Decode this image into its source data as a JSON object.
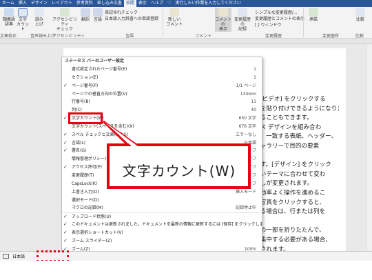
{
  "ribbon": {
    "tabs": [
      "ホーム",
      "挿入",
      "デザイン",
      "レイアウト",
      "参考資料",
      "差し込み文書",
      "校閲",
      "表示",
      "ヘルプ",
      "♡",
      "実行したい作業を入力してください"
    ],
    "active_tab": "校閲",
    "buttons": {
      "thesaurus": "類義語\n辞典",
      "word_count": "文字\nカウント",
      "read_aloud": "読み\n上げ",
      "accessibility": "アクセシビリティ\nチェック",
      "translate": "翻訳",
      "language": "言語",
      "new_comment": "新しい\nコメント",
      "show_comments": "コメントの\n表示",
      "track_changes": "変更履歴の\n記録",
      "accept": "承諾",
      "compare": "比較"
    },
    "small_items": {
      "simplified_check": "表記ゆれチェック",
      "add_dictionary": "日本語入力辞書への単語登録",
      "simple_markup": "シンプルな変更履歴/...",
      "show_markup": "変更履歴とコメントの表示",
      "reviewing_pane": "[ ] ウィンドウ"
    },
    "groups": [
      "文章校正",
      "音声読み上げ",
      "アクセシビリティ",
      "言語",
      "コメント",
      "変更履歴",
      "変更箇所",
      "比較"
    ]
  },
  "menu": {
    "title": "ステータス バーのユーザー設定",
    "items": [
      {
        "label": "書式設定されたページ番号(E)",
        "value": "1",
        "checked": false
      },
      {
        "label": "セクション(E)",
        "value": "1",
        "checked": false
      },
      {
        "label": "ページ番号(P)",
        "value": "1/1 ページ",
        "checked": true
      },
      {
        "label": "ページでの垂直方向の位置(V)",
        "value": "134mm",
        "checked": false
      },
      {
        "label": "行番号(B)",
        "value": "11",
        "checked": false
      },
      {
        "label": "列(C)",
        "value": "40",
        "checked": false
      },
      {
        "label": "文字カウント(W)",
        "value": "650 文字",
        "checked": true
      },
      {
        "label": "文字カウント(スペースを含む)(X)",
        "value": "676 文字",
        "checked": false
      },
      {
        "label": "スペル チェックと文章校正(S)",
        "value": "エラーなし",
        "checked": true
      },
      {
        "label": "言語(L)",
        "value": "日本語",
        "checked": true
      },
      {
        "label": "署名(G)",
        "value": "オフ",
        "checked": true
      },
      {
        "label": "情報管理ポリシー(I)",
        "value": "オフ",
        "checked": false
      },
      {
        "label": "アクセス許可(P)",
        "value": "オフ",
        "checked": true
      },
      {
        "label": "変更履歴(T)",
        "value": "オフ",
        "checked": false
      },
      {
        "label": "CapsLock(K)",
        "value": "オフ",
        "checked": false
      },
      {
        "label": "上書き入力(O)",
        "value": "挿入モード",
        "checked": false
      },
      {
        "label": "選択モード(D)",
        "value": "",
        "checked": false
      },
      {
        "label": "マクロの記録(M)",
        "value": "記録停止中",
        "checked": false
      },
      {
        "label": "アップロード状態(U)",
        "value": "",
        "checked": true
      },
      {
        "label": "このドキュメントは更新されました。ドキュメントを最新の情報に更新するには [保存] をクリックします。",
        "value": "",
        "checked": true
      },
      {
        "label": "表示選択ショートカット(V)",
        "value": "",
        "checked": true
      },
      {
        "label": "ズーム スライダー(Z)",
        "value": "",
        "checked": true
      },
      {
        "label": "ズーム(Z)",
        "value": "100%",
        "checked": true
      }
    ]
  },
  "callout": {
    "text": "文字カウント(W)"
  },
  "document": {
    "lines": [
      "ライン ビデオ] をクリックする",
      "コードを貼り付けできるようになりま",
      "検索することもできます。",
      "ボックス デザインを組み合わ",
      "目的に、一致する表紙、ヘッダー、",
      "えのギャラリーで目的の要素",
      "",
      "できます。[デザイン] をクリック",
      "が新しいテーマに合わせて変わ",
      "に見出しが変更されます。",
      "ため、効率よく操作を進めるこ",
      "には、写真をクリックすると、",
      "している場合は、行または列を",
      "",
      "。文書の一部を折りたたんで、",
      "箇所に集中する必要がある場合、",
      "か記載されます。"
    ]
  },
  "statusbar": {
    "language": "日本語"
  },
  "colors": {
    "brand": "#2b579a",
    "highlight": "#e60012"
  }
}
